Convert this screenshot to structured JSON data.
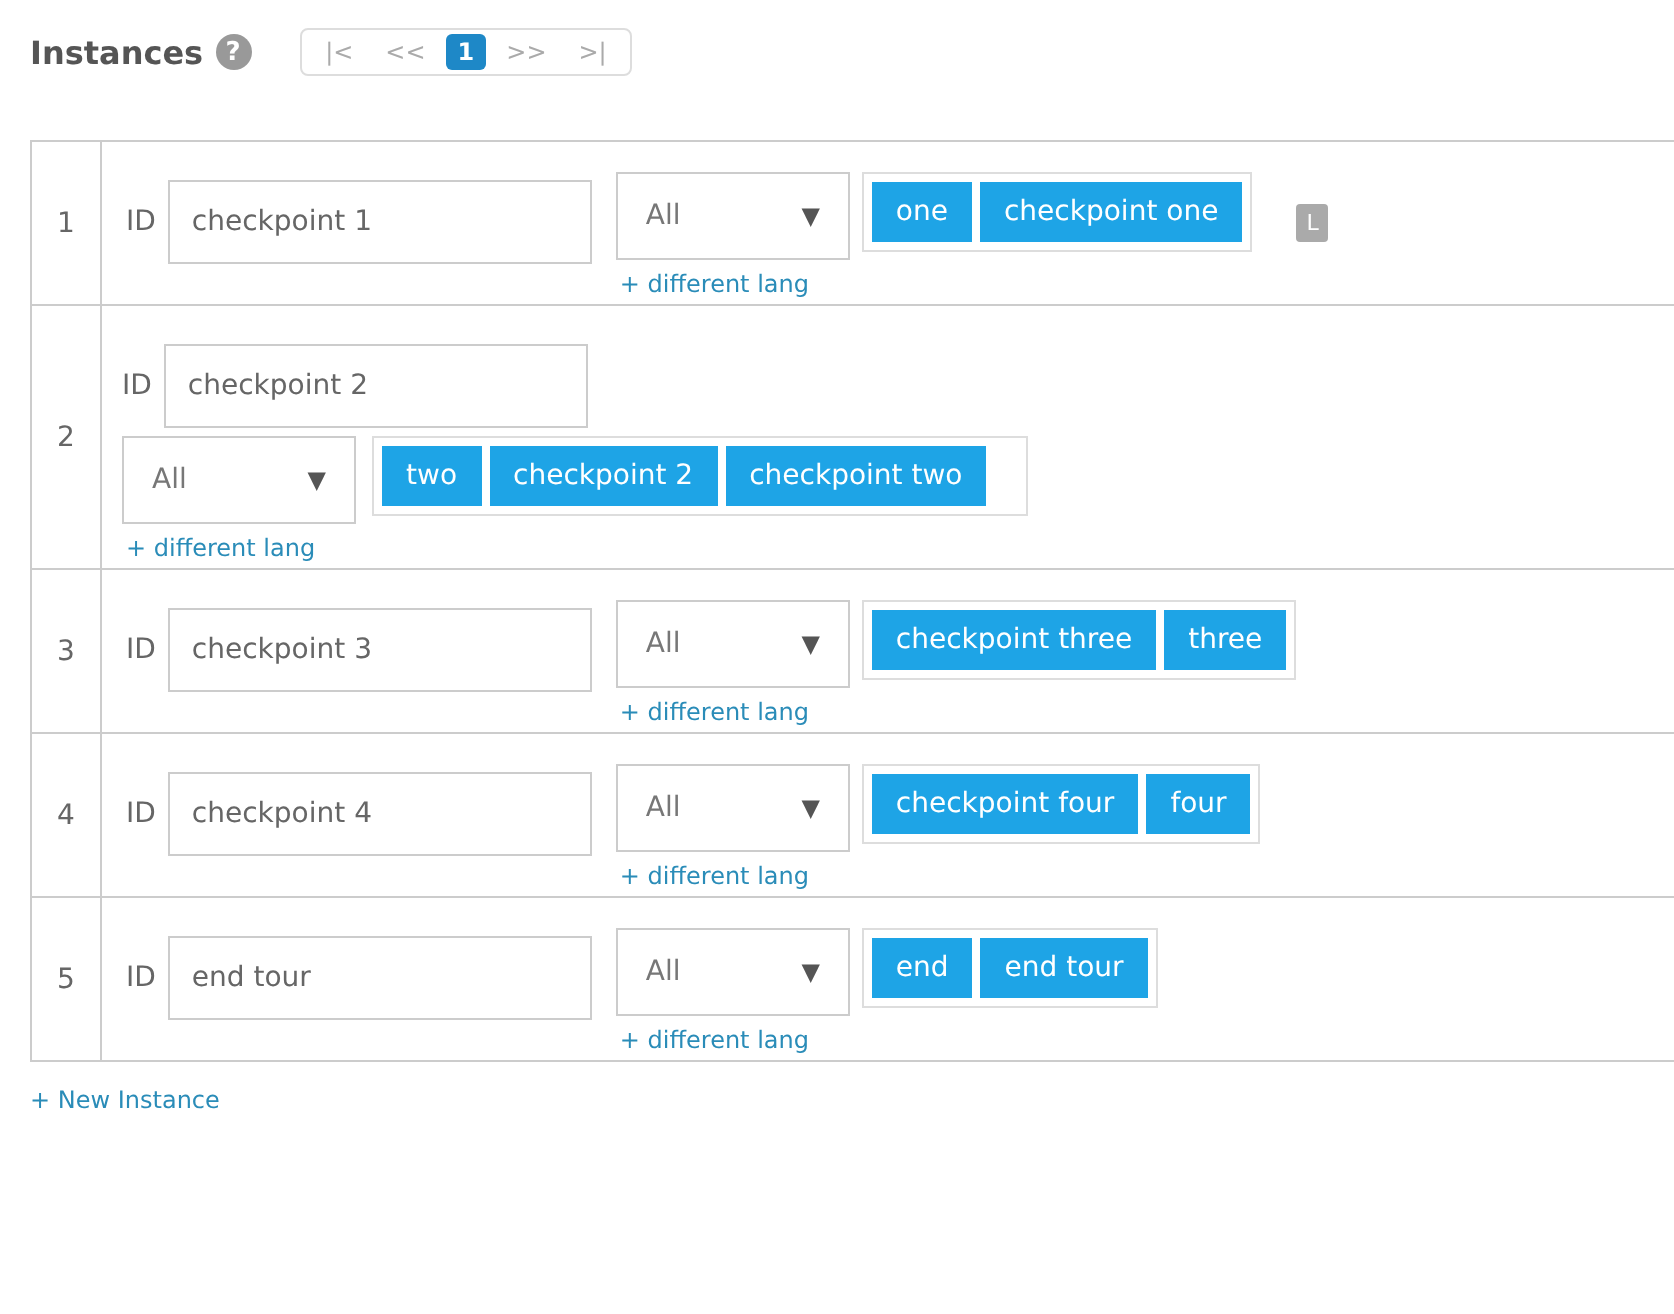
{
  "header": {
    "title": "Instances",
    "help_icon": "?"
  },
  "pager": [
    {
      "label": "|<",
      "selected": false
    },
    {
      "label": "<<",
      "selected": false
    },
    {
      "label": "1",
      "selected": true
    },
    {
      "label": ">>",
      "selected": false
    },
    {
      "label": ">|",
      "selected": false
    }
  ],
  "instances": [
    {
      "number": "1",
      "kind": "inline",
      "id_label": "ID",
      "id_value": "checkpoint 1",
      "lang": "All",
      "lang_arrow": "▼",
      "link": "+ different lang",
      "tags": [
        "one",
        "checkpoint one"
      ],
      "badge": "L"
    },
    {
      "number": "2",
      "kind": "stacked",
      "id_label": "ID",
      "id_value": "checkpoint 2",
      "lang": "All",
      "lang_arrow": "▼",
      "link": "+ different lang",
      "tags": [
        "two",
        "checkpoint 2",
        "checkpoint two"
      ]
    },
    {
      "number": "3",
      "kind": "inline",
      "id_label": "ID",
      "id_value": "checkpoint 3",
      "lang": "All",
      "lang_arrow": "▼",
      "link": "+ different lang",
      "tags": [
        "checkpoint three",
        "three"
      ]
    },
    {
      "number": "4",
      "kind": "inline",
      "id_label": "ID",
      "id_value": "checkpoint 4",
      "lang": "All",
      "lang_arrow": "▼",
      "link": "+ different lang",
      "tags": [
        "checkpoint four",
        "four"
      ]
    },
    {
      "number": "5",
      "kind": "inline",
      "id_label": "ID",
      "id_value": "end tour",
      "lang": "All",
      "lang_arrow": "▼",
      "link": "+ different lang",
      "tags": [
        "end",
        "end tour"
      ]
    }
  ],
  "new_instance": "+ New Instance"
}
